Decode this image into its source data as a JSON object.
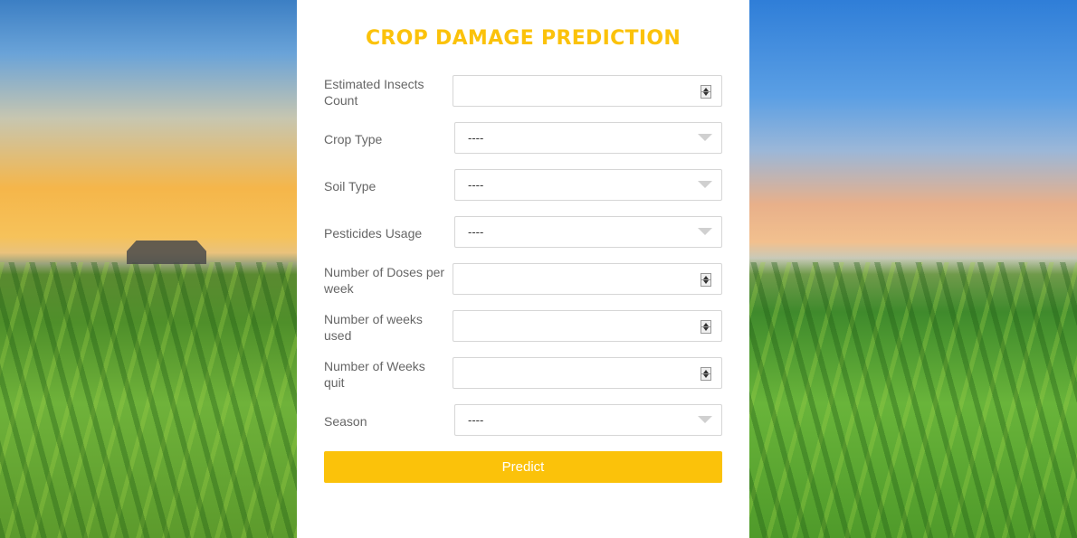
{
  "page": {
    "title": "CROP DAMAGE PREDICTION",
    "accent_color": "#fbc20a"
  },
  "form": {
    "fields": [
      {
        "label": "Estimated Insects Count",
        "type": "number",
        "value": ""
      },
      {
        "label": "Crop Type",
        "type": "select",
        "value": "----"
      },
      {
        "label": "Soil Type",
        "type": "select",
        "value": "----"
      },
      {
        "label": "Pesticides Usage",
        "type": "select",
        "value": "----"
      },
      {
        "label": "Number of Doses per week",
        "type": "number",
        "value": ""
      },
      {
        "label": "Number of weeks used",
        "type": "number",
        "value": ""
      },
      {
        "label": "Number of Weeks quit",
        "type": "number",
        "value": ""
      },
      {
        "label": "Season",
        "type": "select",
        "value": "----"
      }
    ],
    "submit_label": "Predict"
  },
  "icons": {
    "spinner": "number-spinner-icon",
    "dropdown": "chevron-down-icon"
  }
}
